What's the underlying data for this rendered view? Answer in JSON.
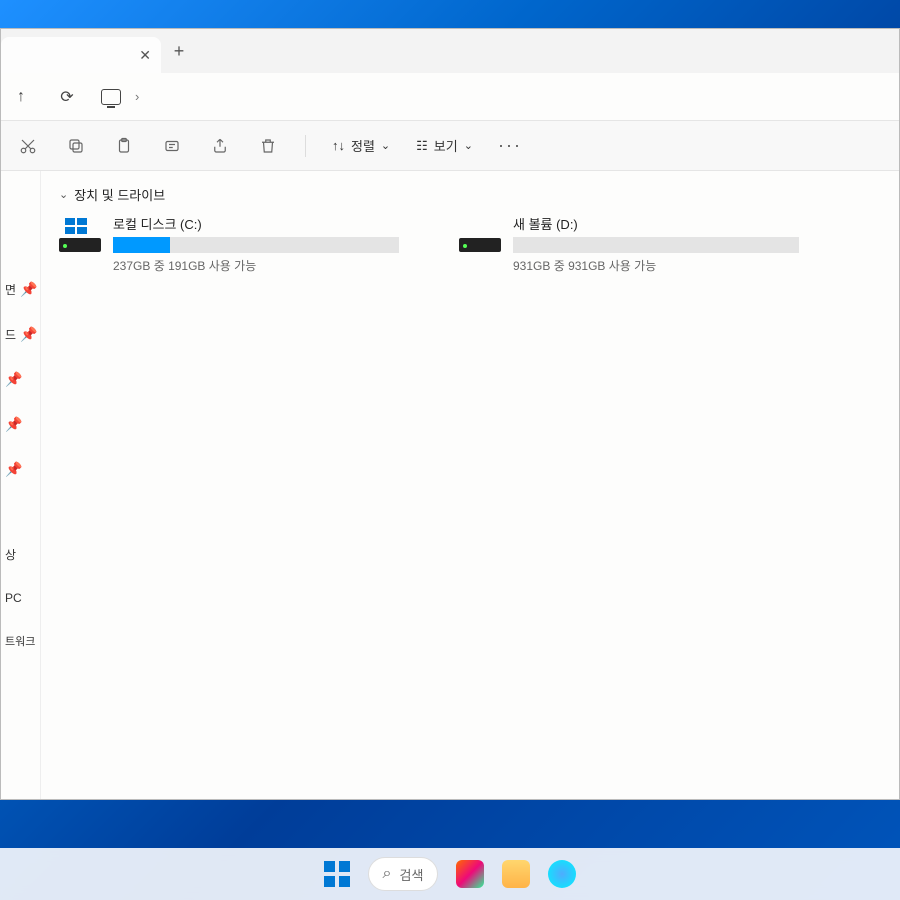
{
  "tabbar": {
    "close_glyph": "✕",
    "newtab_glyph": "+"
  },
  "addrbar": {
    "up_glyph": "↑",
    "refresh_glyph": "⟳",
    "path_chevron": "›"
  },
  "toolbar": {
    "sort_arrow": "↑↓",
    "sort_label": "정렬",
    "view_icon": "☷",
    "view_label": "보기",
    "more_glyph": "···",
    "chev": "⌄"
  },
  "section": {
    "chev": "⌄",
    "title": "장치 및 드라이브"
  },
  "drives": [
    {
      "name": "로컬 디스크 (C:)",
      "status": "237GB 중 191GB 사용 가능",
      "fill_pct": 20,
      "has_winlogo": true
    },
    {
      "name": "새 볼륨 (D:)",
      "status": "931GB 중 931GB 사용 가능",
      "fill_pct": 0,
      "has_winlogo": false
    }
  ],
  "sidebar": {
    "items": [
      {
        "label": "면",
        "pinned": true
      },
      {
        "label": "드",
        "pinned": true
      },
      {
        "label": "",
        "pinned": true
      },
      {
        "label": "",
        "pinned": true
      },
      {
        "label": "",
        "pinned": true
      },
      {
        "label": "상",
        "pinned": false
      },
      {
        "label": "PC",
        "pinned": false
      },
      {
        "label": "트워크",
        "pinned": false
      }
    ]
  },
  "taskbar": {
    "search_glyph": "⌕",
    "search_placeholder": "검색"
  }
}
